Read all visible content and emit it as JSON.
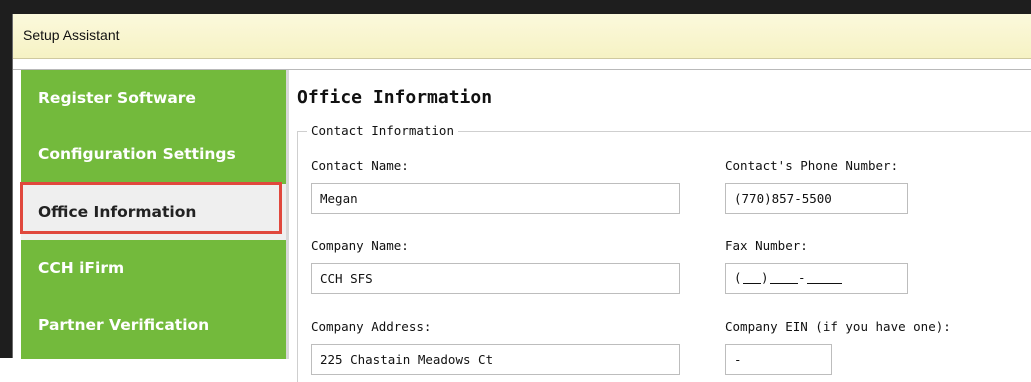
{
  "window": {
    "title": "Setup Assistant"
  },
  "sidebar": {
    "items": [
      {
        "label": "Register Software"
      },
      {
        "label": "Configuration Settings"
      },
      {
        "label": "Office Information"
      },
      {
        "label": "CCH iFirm"
      },
      {
        "label": "Partner Verification"
      }
    ],
    "active_index": 2
  },
  "main": {
    "heading": "Office Information",
    "section_legend": "Contact Information",
    "fields": {
      "contact_name": {
        "label": "Contact Name:",
        "value": "Megan"
      },
      "contact_phone": {
        "label": "Contact's Phone Number:",
        "value": "(770)857-5500"
      },
      "company_name": {
        "label": "Company Name:",
        "value": "CCH SFS"
      },
      "fax_number": {
        "label": "Fax Number:",
        "value": "(___)___-____",
        "open_paren": "(",
        "close_paren": ")",
        "dash": "-"
      },
      "company_address": {
        "label": "Company Address:",
        "value": "225 Chastain Meadows Ct"
      },
      "company_ein": {
        "label": "Company EIN (if you have one):",
        "value": "-"
      }
    }
  },
  "colors": {
    "sidebar_bg": "#73ba3c",
    "active_bg": "#efefef",
    "highlight_border": "#e0483d",
    "titlebar_bg": "#f6f2c4"
  }
}
